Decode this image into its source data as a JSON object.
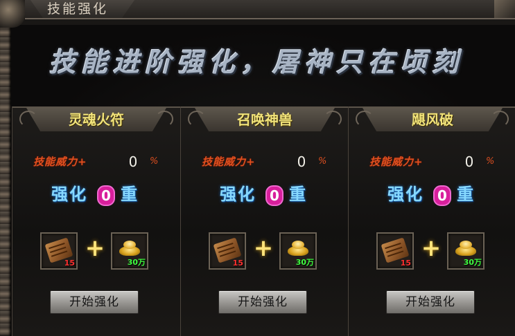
{
  "window": {
    "title": "技能强化"
  },
  "banner": {
    "text": "技能进阶强化，屠神只在顷刻"
  },
  "panels": [
    {
      "name": "灵魂火符",
      "power_label": "技能威力+",
      "power_value": "0",
      "power_unit": "%",
      "level_prefix": "强化",
      "level_value": "0",
      "level_suffix": "重",
      "item_a_qty": "15",
      "item_b_qty": "30万",
      "plus": "+",
      "button": "开始强化"
    },
    {
      "name": "召唤神兽",
      "power_label": "技能威力+",
      "power_value": "0",
      "power_unit": "%",
      "level_prefix": "强化",
      "level_value": "0",
      "level_suffix": "重",
      "item_a_qty": "15",
      "item_b_qty": "30万",
      "plus": "+",
      "button": "开始强化"
    },
    {
      "name": "飓风破",
      "power_label": "技能威力+",
      "power_value": "0",
      "power_unit": "%",
      "level_prefix": "强化",
      "level_value": "0",
      "level_suffix": "重",
      "item_a_qty": "15",
      "item_b_qty": "30万",
      "plus": "+",
      "button": "开始强化"
    }
  ],
  "icons": {
    "item_a": "scroll-icon",
    "item_b": "gold-ingot-icon"
  },
  "colors": {
    "skill_name": "#f1e37a",
    "power_label": "#e05020",
    "level_text": "#86d8ff",
    "level_badge": "#d81f9c",
    "qty_a": "#ff3030",
    "qty_b": "#40ff40"
  }
}
